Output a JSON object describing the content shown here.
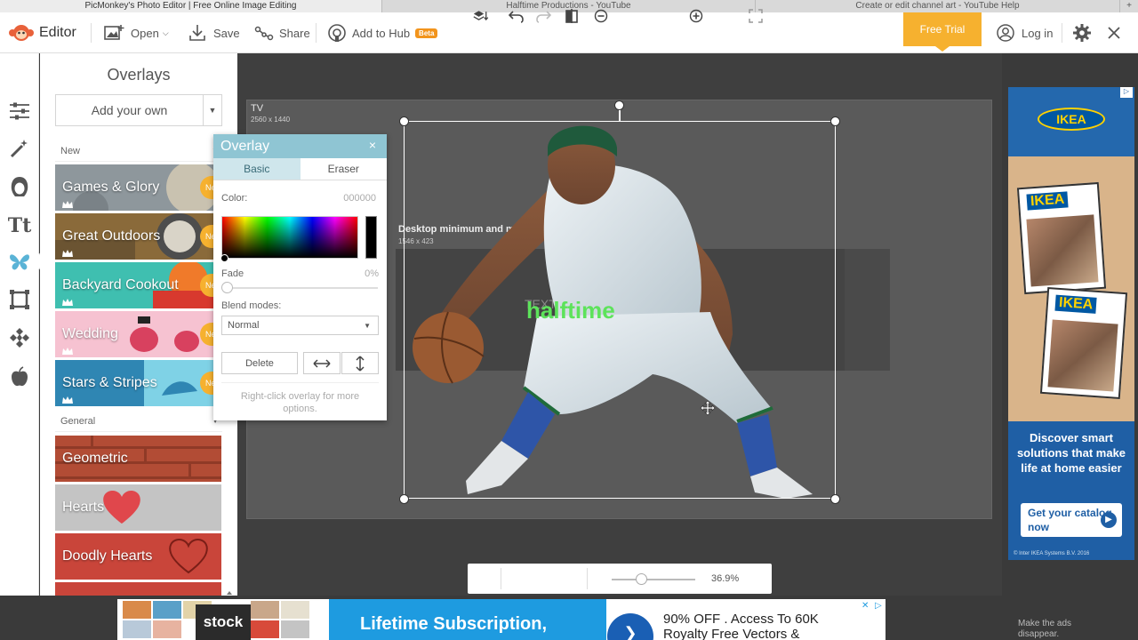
{
  "browser_tabs": [
    {
      "title": "PicMonkey's Photo Editor | Free Online Image Editing",
      "active": true
    },
    {
      "title": "Halftime Productions - YouTube",
      "active": false
    },
    {
      "title": "Create or edit channel art - YouTube Help",
      "active": false
    }
  ],
  "browser_new_tab": "+",
  "header": {
    "app_name": "Editor",
    "open_label": "Open",
    "save_label": "Save",
    "share_label": "Share",
    "hub_label": "Add to Hub",
    "beta_badge": "Beta",
    "free_trial_label": "Free Trial",
    "login_label": "Log in"
  },
  "rail_icons": [
    "adjust-icon",
    "magic-wand-icon",
    "touch-up-icon",
    "text-icon",
    "overlay-butterfly-icon",
    "frame-icon",
    "texture-icon",
    "apple-icon"
  ],
  "panel": {
    "title": "Overlays",
    "add_own_label": "Add your own",
    "section_new": "New",
    "section_general": "General",
    "new_items": [
      {
        "label": "Games & Glory",
        "badge": "New",
        "color": "#9aa3a8"
      },
      {
        "label": "Great Outdoors",
        "badge": "New",
        "color": "#a07a3a"
      },
      {
        "label": "Backyard Cookout",
        "badge": "New",
        "color": "#3fbfb0"
      },
      {
        "label": "Wedding",
        "badge": "New",
        "color": "#f3b9c8"
      },
      {
        "label": "Stars & Stripes",
        "badge": "New",
        "color": "#2e7fa8"
      }
    ],
    "general_items": [
      {
        "label": "Geometric",
        "color": "#b9523a"
      },
      {
        "label": "Hearts",
        "color": "#c9c9c9"
      },
      {
        "label": "Doodly Hearts",
        "color": "#c9453a"
      }
    ]
  },
  "canvas": {
    "tv_label": "TV",
    "tv_size": "2560 x 1440",
    "desktop_label": "Desktop minimum and m",
    "desktop_size": "1546 x 423",
    "text_logo": "TEXT AND LOGO",
    "logo_word": "halftime"
  },
  "overlay_dialog": {
    "title": "Overlay",
    "close": "×",
    "tab_basic": "Basic",
    "tab_eraser": "Eraser",
    "color_label": "Color:",
    "color_hex": "000000",
    "fade_label": "Fade",
    "fade_value": "0%",
    "blend_label": "Blend modes:",
    "blend_value": "Normal",
    "delete_label": "Delete",
    "hint": "Right-click overlay for more options."
  },
  "bottom_toolbar": {
    "zoom_percent": "36.9%",
    "zoom_level": 0.369
  },
  "ikea_ad": {
    "brand": "IKEA",
    "headline": "Discover smart solutions that make life at home easier",
    "cta": "Get your catalog now",
    "legal": "© Inter IKEA Systems B.V. 2016"
  },
  "bottom_ad": {
    "stock_logo": "stock",
    "headline": "Lifetime Subscription,",
    "offer": "90% OFF . Access To 60K Royalty Free Vectors &"
  },
  "ads_disappear": "Make the ads disappear."
}
